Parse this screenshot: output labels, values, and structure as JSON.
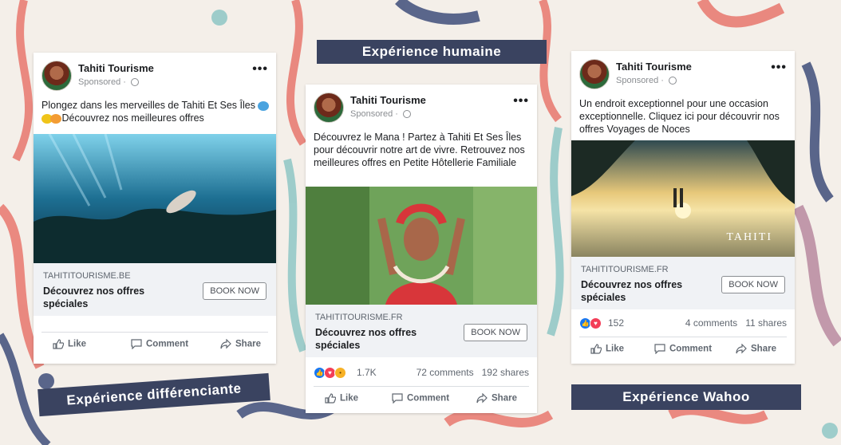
{
  "banners": {
    "left": "Expérience différenciante",
    "middle": "Expérience humaine",
    "right": "Expérience Wahoo"
  },
  "common": {
    "page_name": "Tahiti Tourisme",
    "sponsored": "Sponsored",
    "more": "•••",
    "book_now": "BOOK NOW",
    "like": "Like",
    "comment": "Comment",
    "share": "Share"
  },
  "posts": [
    {
      "text": "Plongez dans les merveilles de Tahiti Et Ses Îles",
      "text_after_emoji": "Découvrez nos meilleures offres",
      "domain": "TAHITITOURISME.BE",
      "link_title": "Découvrez nos offres spéciales"
    },
    {
      "text": "Découvrez le Mana ! Partez à Tahiti Et Ses Îles pour découvrir notre art de vivre. Retrouvez nos meilleures offres en Petite Hôtellerie Familiale",
      "domain": "TAHITITOURISME.FR",
      "link_title": "Découvrez nos offres spéciales",
      "reactions": "1.7K",
      "comments": "72 comments",
      "shares": "192 shares"
    },
    {
      "text": "Un endroit exceptionnel pour une occasion exceptionnelle. Cliquez ici pour découvrir nos offres Voyages de Noces",
      "domain": "TAHITITOURISME.FR",
      "link_title": "Découvrez nos offres spéciales",
      "reactions": "152",
      "comments": "4 comments",
      "shares": "11 shares",
      "image_caption": "TAHITI"
    }
  ],
  "colors": {
    "banner": "#3a4360",
    "facebook_blue": "#1877f2",
    "coral": "#e8776d",
    "navy_leaf": "#3e4d7a",
    "teal": "#8ec7c5",
    "mauve": "#b98aa0"
  }
}
